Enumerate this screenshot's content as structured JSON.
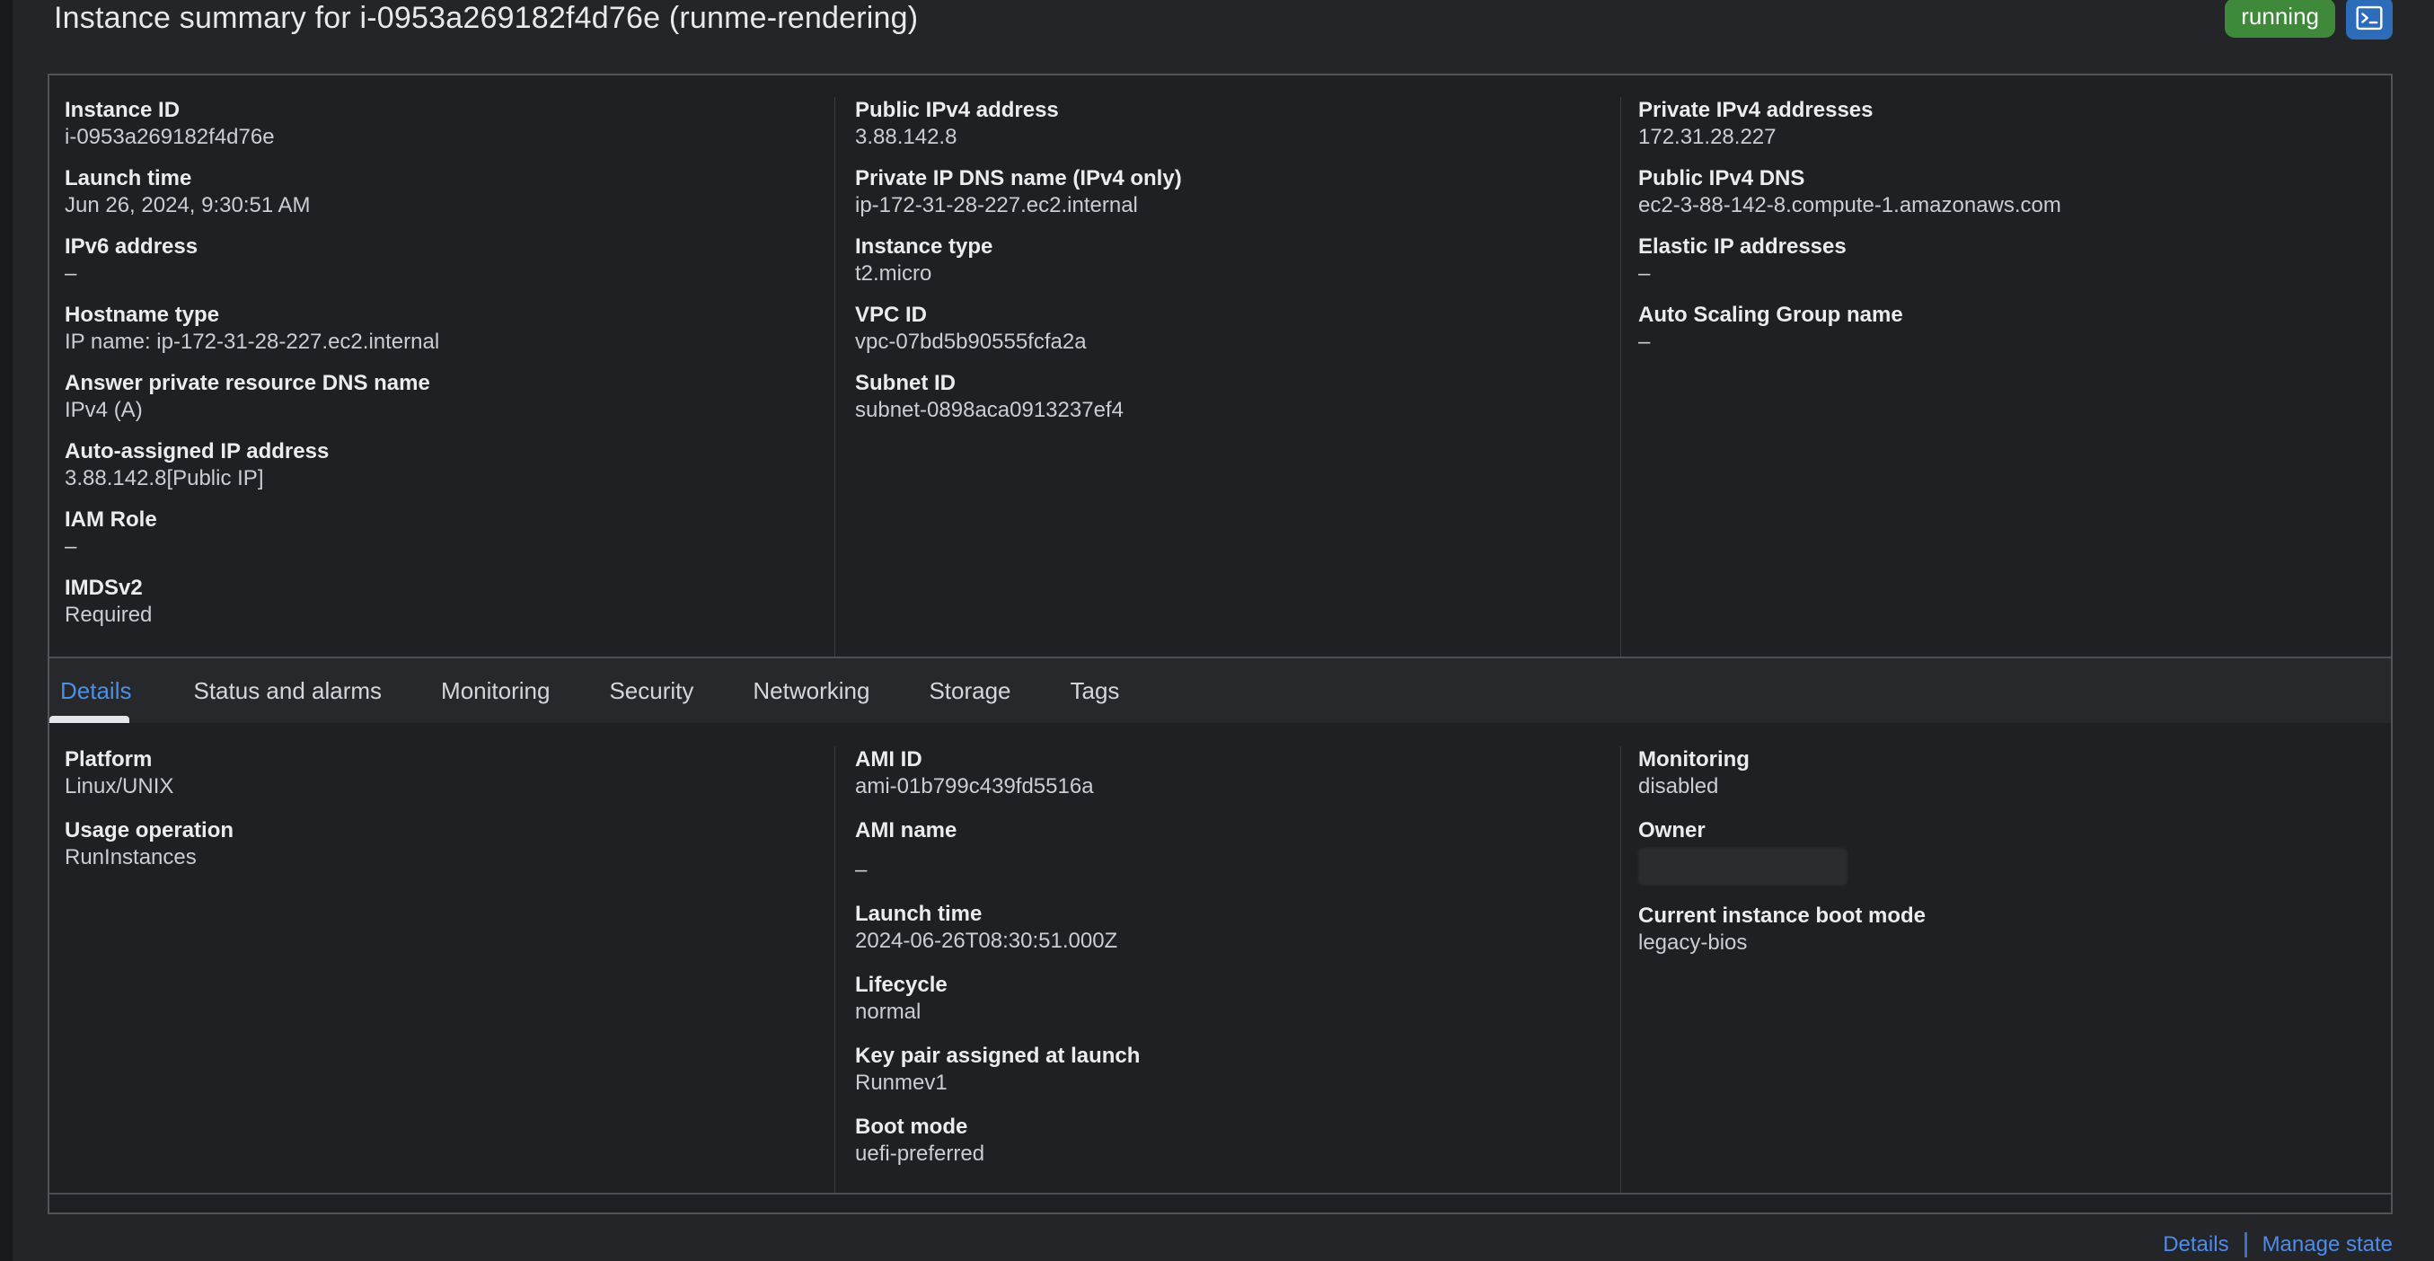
{
  "header": {
    "title": "Instance summary for i-0953a269182f4d76e (runme-rendering)",
    "status": "running"
  },
  "summary": {
    "col1": [
      {
        "label": "Instance ID",
        "value": "i-0953a269182f4d76e"
      },
      {
        "label": "Launch time",
        "value": "Jun 26, 2024, 9:30:51 AM"
      },
      {
        "label": "IPv6 address",
        "value": "–"
      },
      {
        "label": "Hostname type",
        "value": "IP name: ip-172-31-28-227.ec2.internal"
      },
      {
        "label": "Answer private resource DNS name",
        "value": "IPv4 (A)"
      },
      {
        "label": "Auto-assigned IP address",
        "value": "3.88.142.8[Public IP]"
      },
      {
        "label": "IAM Role",
        "value": "–"
      },
      {
        "label": "IMDSv2",
        "value": "Required"
      }
    ],
    "col2": [
      {
        "label": "Public IPv4 address",
        "value": "3.88.142.8"
      },
      {
        "label": "Private IP DNS name (IPv4 only)",
        "value": "ip-172-31-28-227.ec2.internal"
      },
      {
        "label": "Instance type",
        "value": "t2.micro"
      },
      {
        "label": "VPC ID",
        "value": "vpc-07bd5b90555fcfa2a"
      },
      {
        "label": "Subnet ID",
        "value": "subnet-0898aca0913237ef4"
      }
    ],
    "col3": [
      {
        "label": "Private IPv4 addresses",
        "value": "172.31.28.227"
      },
      {
        "label": "Public IPv4 DNS",
        "value": "ec2-3-88-142-8.compute-1.amazonaws.com"
      },
      {
        "label": "Elastic IP addresses",
        "value": "–"
      },
      {
        "label": "Auto Scaling Group name",
        "value": "–"
      }
    ]
  },
  "tabs": [
    {
      "label": "Details"
    },
    {
      "label": "Status and alarms"
    },
    {
      "label": "Monitoring"
    },
    {
      "label": "Security"
    },
    {
      "label": "Networking"
    },
    {
      "label": "Storage"
    },
    {
      "label": "Tags"
    }
  ],
  "details": {
    "col1": [
      {
        "label": "Platform",
        "value": "Linux/UNIX"
      },
      {
        "label": "Usage operation",
        "value": "RunInstances"
      }
    ],
    "col2": [
      {
        "label": "AMI ID",
        "value": "ami-01b799c439fd5516a"
      },
      {
        "label": "AMI name",
        "value": "–"
      },
      {
        "label": "Launch time",
        "value": "2024-06-26T08:30:51.000Z"
      },
      {
        "label": "Lifecycle",
        "value": "normal"
      },
      {
        "label": "Key pair assigned at launch",
        "value": "Runmev1"
      },
      {
        "label": "Boot mode",
        "value": "uefi-preferred"
      }
    ],
    "col3": [
      {
        "label": "Monitoring",
        "value": "disabled"
      },
      {
        "label": "Owner",
        "value": ""
      },
      {
        "label": "Current instance boot mode",
        "value": "legacy-bios"
      }
    ]
  },
  "footer": {
    "details": "Details",
    "manage_state": "Manage state"
  },
  "colors": {
    "status_running_green": "#3e8a3a",
    "link_blue": "#4a90e8",
    "connect_button_blue": "#2d6cb8",
    "active_tab_blue": "#4a90e8"
  },
  "icons": {
    "connect": "terminal-icon"
  }
}
